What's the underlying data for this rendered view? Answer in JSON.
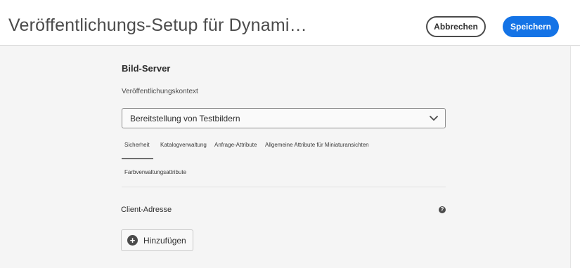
{
  "header": {
    "title": "Veröffentlichungs-Setup für Dynami…",
    "cancel_label": "Abbrechen",
    "save_label": "Speichern"
  },
  "section": {
    "title": "Bild-Server",
    "context_label": "Veröffentlichungskontext",
    "context_value": "Bereitstellung von Testbildern"
  },
  "tabs": [
    {
      "label": "Sicherheit",
      "selected": true
    },
    {
      "label": "Katalogverwaltung",
      "selected": false
    },
    {
      "label": "Anfrage-Attribute",
      "selected": false
    },
    {
      "label": "Allgemeine Attribute für Miniaturansichten",
      "selected": false
    },
    {
      "label": "Farbverwaltungsattribute",
      "selected": false
    }
  ],
  "client": {
    "label": "Client-Adresse",
    "help_icon": "help-icon",
    "add_label": "Hinzufügen"
  },
  "colors": {
    "accent": "#1473e6",
    "background": "#f5f5f5",
    "header_bg": "#ffffff"
  }
}
